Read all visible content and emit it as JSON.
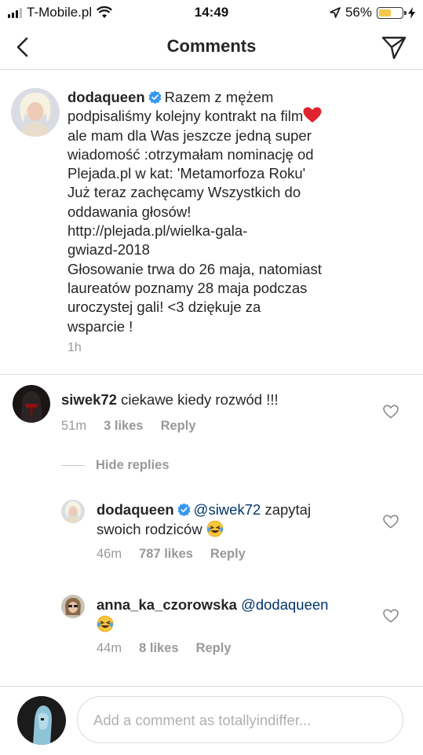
{
  "status_bar": {
    "carrier": "T-Mobile.pl",
    "time": "14:49",
    "battery_percent": "56%",
    "battery_level": 0.56,
    "battery_color": "#f4c84a"
  },
  "header": {
    "title": "Comments",
    "back_icon": "chevron-left-icon",
    "send_icon": "paper-plane-icon"
  },
  "caption": {
    "username": "dodaqueen",
    "lines": [
      "Razem z mężem",
      "podpisaliśmy kolejny kontrakt na film",
      "ale mam dla Was jeszcze jedną super",
      "wiadomość :otrzymałam nominację od",
      "Plejada.pl w kat: 'Metamorfoza Roku'",
      "Już teraz zachęcamy Wszystkich do",
      "oddawania głosów!",
      "http://plejada.pl/wielka-gala-",
      "gwiazd-2018",
      "Głosowanie trwa do 26 maja, natomiast",
      "laureatów poznamy 28 maja podczas",
      "uroczystej gali! <3 dziękuje za",
      "wsparcie !"
    ],
    "time": "1h"
  },
  "comments": [
    {
      "username": "siwek72",
      "text": "ciekawe kiedy rozwód !!!",
      "time": "51m",
      "likes": "3 likes",
      "reply_label": "Reply"
    }
  ],
  "hide_replies_label": "Hide replies",
  "replies": [
    {
      "username": "dodaqueen",
      "mention": "@siwek72",
      "text_line1": "zapytaj",
      "text_line2": "swoich rodziców",
      "emoji": "laughing-tears-emoji",
      "time": "46m",
      "likes": "787 likes",
      "reply_label": "Reply"
    },
    {
      "username": "anna_ka_czorowska",
      "mention": "@dodaqueen",
      "emoji": "laughing-tears-emoji",
      "time": "44m",
      "likes": "8 likes",
      "reply_label": "Reply"
    }
  ],
  "composer": {
    "placeholder": "Add a comment as totallyindiffer..."
  },
  "colors": {
    "verified": "#3897f0",
    "text": "#262626",
    "muted": "#999999",
    "mention": "#003569"
  }
}
